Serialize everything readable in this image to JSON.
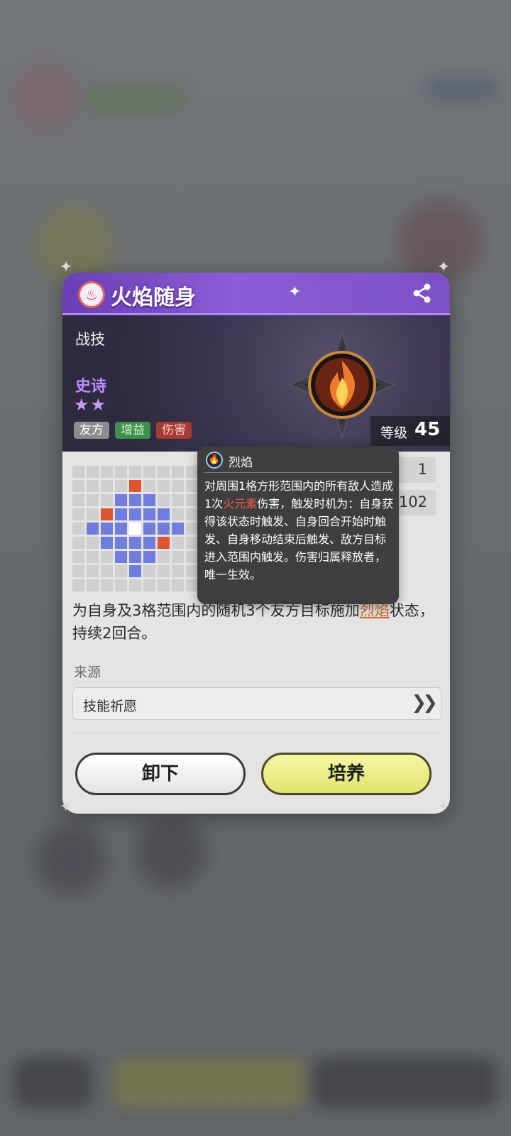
{
  "skill": {
    "name": "火焰随身",
    "type": "战技",
    "rarity": "史诗",
    "stars": "★★",
    "tags": [
      "友方",
      "增益",
      "伤害"
    ],
    "level_label": "等级",
    "level_value": "45"
  },
  "stats": [
    {
      "label": "",
      "value": "1"
    },
    {
      "label": "",
      "value": "+1102"
    }
  ],
  "description": {
    "before": "为自身及3格范围内的随机3个友方目标施加",
    "highlight": "烈焰",
    "after": "状态，持续2回合。"
  },
  "source": {
    "label": "来源",
    "value": "技能祈愿"
  },
  "buttons": {
    "unequip": "卸下",
    "train": "培养"
  },
  "tooltip": {
    "title": "烈焰",
    "body_before": "对周围1格方形范围内的所有敌人造成1次",
    "body_highlight": "火元素",
    "body_after": "伤害，触发时机为：自身获得该状态时触发、自身回合开始时触发、自身移动结束后触发、敌方目标进入范围内触发。伤害归属释放者，唯一生效。"
  },
  "range_grid": {
    "size": 9,
    "cells": [
      "000000000",
      "000010000",
      "000222000",
      "001222200",
      "022232220",
      "002222100",
      "000222000",
      "000020000",
      "000000000"
    ]
  },
  "colors": {
    "title_purple": "#7b4fc6",
    "rarity_purple": "#c08cff",
    "range_blue": "#6f7de0",
    "range_orange": "#e0552e",
    "fire_text": "#ff5a3c",
    "train_yellow": "#e2e46e"
  },
  "icons": {
    "title": "fire-crest-icon",
    "share": "share-icon",
    "sparkle": "sparkle-icon",
    "emblem": "flame-emblem-icon",
    "tooltip": "flame-icon",
    "source_arrow": "double-chevron-right-icon"
  }
}
